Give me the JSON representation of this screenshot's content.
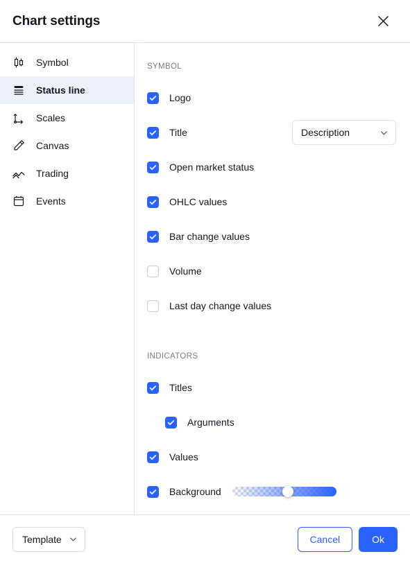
{
  "header": {
    "title": "Chart settings",
    "close_icon": "close-icon"
  },
  "sidebar": {
    "items": [
      {
        "label": "Symbol",
        "icon": "candlestick-icon",
        "active": false
      },
      {
        "label": "Status line",
        "icon": "status-line-icon",
        "active": true
      },
      {
        "label": "Scales",
        "icon": "axes-icon",
        "active": false
      },
      {
        "label": "Canvas",
        "icon": "pencil-icon",
        "active": false
      },
      {
        "label": "Trading",
        "icon": "trading-zigzag-icon",
        "active": false
      },
      {
        "label": "Events",
        "icon": "calendar-icon",
        "active": false
      }
    ]
  },
  "main": {
    "sections": [
      {
        "title": "SYMBOL",
        "rows": [
          {
            "label": "Logo",
            "checked": true
          },
          {
            "label": "Title",
            "checked": true,
            "select_value": "Description"
          },
          {
            "label": "Open market status",
            "checked": true
          },
          {
            "label": "OHLC values",
            "checked": true
          },
          {
            "label": "Bar change values",
            "checked": true
          },
          {
            "label": "Volume",
            "checked": false
          },
          {
            "label": "Last day change values",
            "checked": false
          }
        ]
      },
      {
        "title": "INDICATORS",
        "rows": [
          {
            "label": "Titles",
            "checked": true
          },
          {
            "label": "Arguments",
            "checked": true,
            "indent": true
          },
          {
            "label": "Values",
            "checked": true
          },
          {
            "label": "Background",
            "checked": true,
            "slider_value": 50
          }
        ]
      }
    ]
  },
  "footer": {
    "template_label": "Template",
    "cancel_label": "Cancel",
    "ok_label": "Ok"
  },
  "colors": {
    "accent": "#2962ff",
    "border": "#e0e3eb",
    "active_bg": "#eef1f9",
    "muted_text": "#787b86",
    "text": "#131722"
  }
}
